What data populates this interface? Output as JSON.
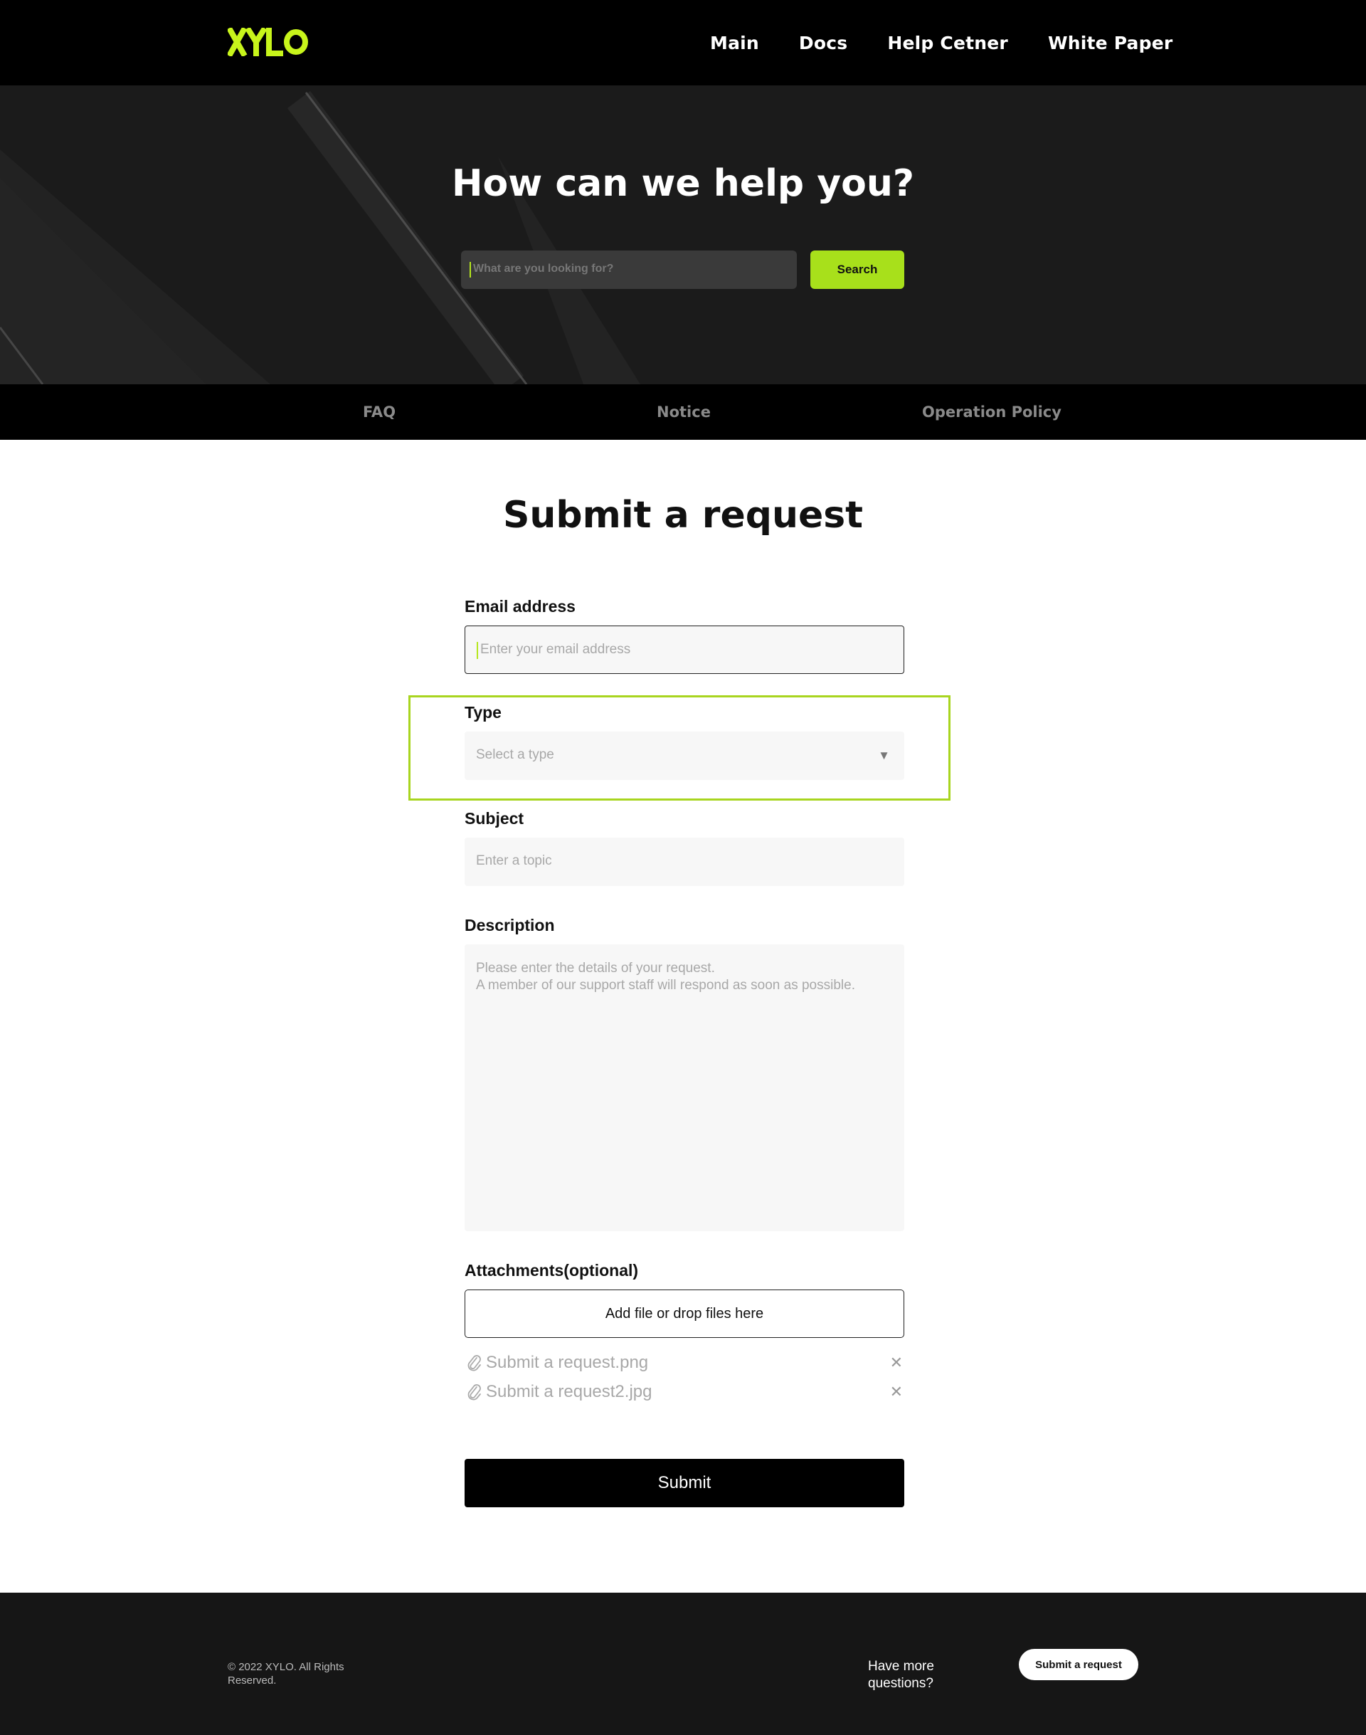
{
  "header": {
    "logo_text": "XYLO",
    "brand_color": "#c8f51b",
    "nav": [
      "Main",
      "Docs",
      "Help Cetner",
      "White Paper"
    ]
  },
  "hero": {
    "title": "How can we help you?",
    "search_placeholder": "What are you looking for?",
    "search_button": "Search"
  },
  "tabs": [
    "FAQ",
    "Notice",
    "Operation Policy"
  ],
  "form": {
    "title": "Submit a request",
    "email_label": "Email address",
    "email_placeholder": "Enter your email address",
    "type_label": "Type",
    "type_placeholder": "Select a type",
    "subject_label": "Subject",
    "subject_placeholder": "Enter a topic",
    "description_label": "Description",
    "description_placeholder_line1": "Please enter the details of your request.",
    "description_placeholder_line2": "A member of our support staff will respond as soon as possible.",
    "attachments_label": "Attachments(optional)",
    "attach_button": "Add file or drop files here",
    "files": [
      "Submit a request.png",
      "Submit a request2.jpg"
    ],
    "submit_button": "Submit"
  },
  "footer": {
    "copyright": "© 2022 XYLO. All Rights Reserved.",
    "more_questions": "Have more questions?",
    "submit_request_button": "Submit a request"
  },
  "colors": {
    "accent": "#a8e01b",
    "highlight_border": "#a8d51f",
    "dark": "#000000"
  }
}
